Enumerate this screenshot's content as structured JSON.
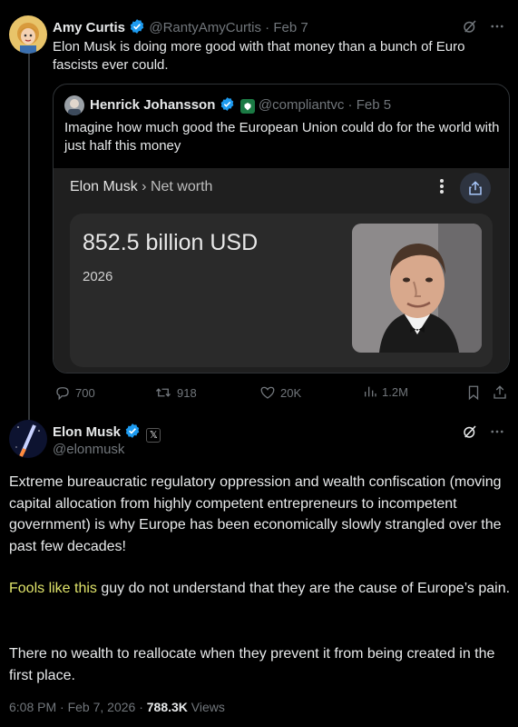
{
  "tweet1": {
    "author_name": "Amy Curtis",
    "handle": "@RantyAmyCurtis",
    "date": "Feb 7",
    "text": "Elon Musk is doing more good with that money than a bunch of Euro fascists ever could.",
    "quote": {
      "author_name": "Henrick Johansson",
      "handle": "@compliantvc",
      "date": "Feb 5",
      "text": "Imagine how much good the European Union could do for the world with just half this money",
      "embed": {
        "title_name": "Elon Musk",
        "title_separator": "›",
        "title_section": "Net worth",
        "value": "852.5 billion USD",
        "year": "2026"
      }
    },
    "actions": {
      "replies": "700",
      "reposts": "918",
      "likes": "20K",
      "views": "1.2M"
    }
  },
  "tweet2": {
    "author_name": "Elon Musk",
    "handle": "@elonmusk",
    "paragraph1": "Extreme bureaucratic regulatory oppression and wealth confiscation (moving capital allocation from highly competent entrepreneurs to incompetent government) is why Europe has been economically slowly strangled over the past few decades!",
    "paragraph2_highlight": "Fools like this",
    "paragraph2_rest": " guy do not understand that they are the cause of Europe’s pain.",
    "paragraph3": "There no wealth to reallocate when they prevent it from being created in the first place.",
    "time": "6:08 PM · Feb 7, 2026 · ",
    "views_count": "788.3K",
    "views_label": " Views"
  },
  "colors": {
    "background": "#000000",
    "text": "#e7e9ea",
    "muted": "#71767b",
    "verified": "#1d9bf0",
    "highlight": "#dfe36a"
  },
  "icons": [
    "grok-icon",
    "more-icon",
    "verified-icon",
    "reply-icon",
    "repost-icon",
    "like-icon",
    "views-icon",
    "bookmark-icon",
    "share-icon"
  ]
}
